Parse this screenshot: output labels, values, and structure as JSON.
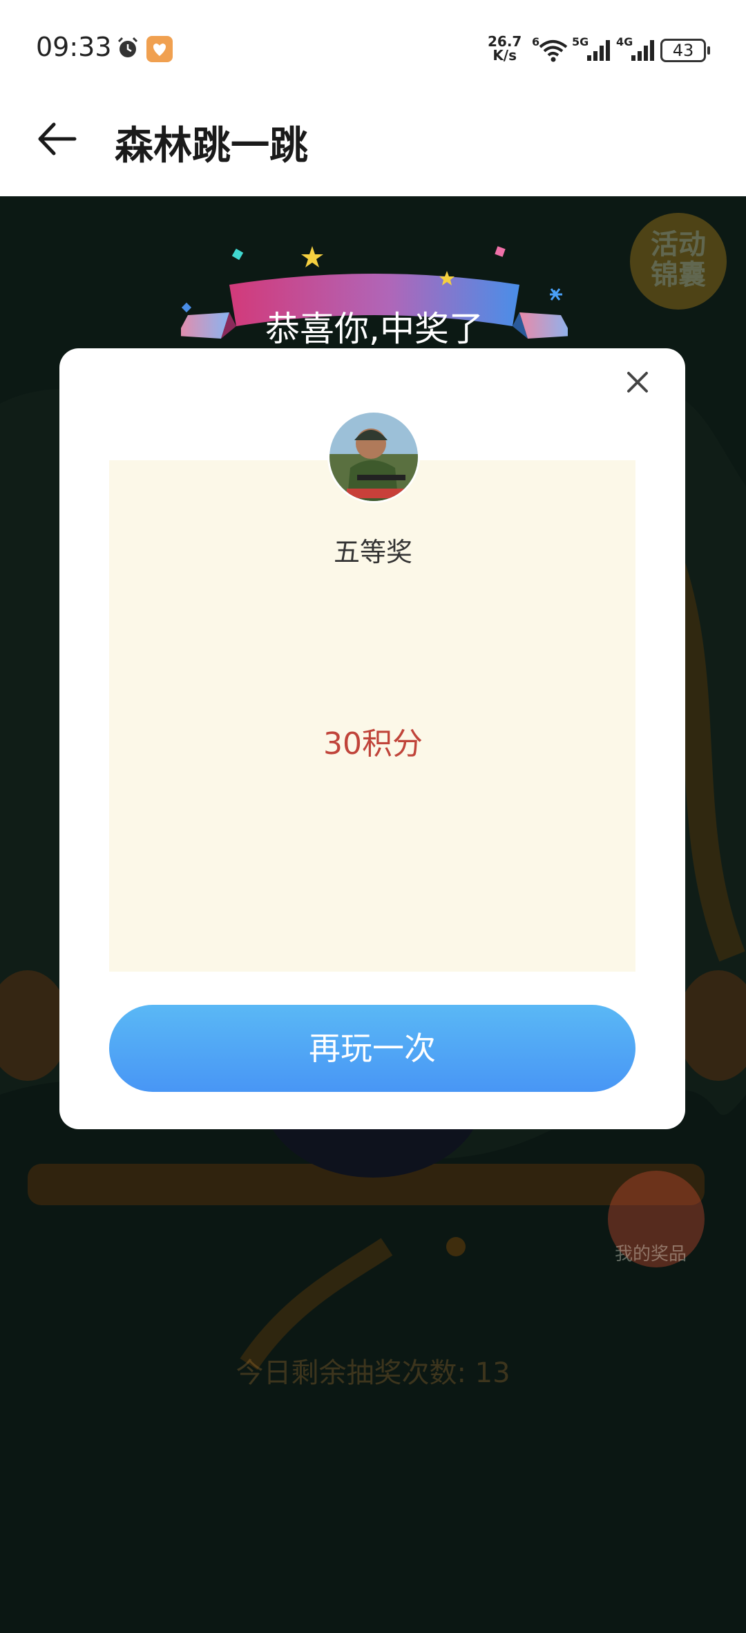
{
  "status_bar": {
    "time": "09:33",
    "net_speed_value": "26.7",
    "net_speed_unit": "K/s",
    "wifi_label": "6",
    "signal1_label": "5G",
    "signal2_label": "4G",
    "battery": "43"
  },
  "header": {
    "title": "森林跳一跳"
  },
  "background": {
    "activity_badge": "活动\n锦囊",
    "my_prize_label": "我的奖品",
    "remaining_text": "今日剩余抽奖次数: 13"
  },
  "modal": {
    "banner_text": "恭喜你,中奖了",
    "prize_level": "五等奖",
    "prize_value": "30积分",
    "play_again_label": "再玩一次"
  },
  "colors": {
    "accent_blue": "#4896f5",
    "prize_red": "#c0443a",
    "panel_cream": "#fcf8e8"
  }
}
